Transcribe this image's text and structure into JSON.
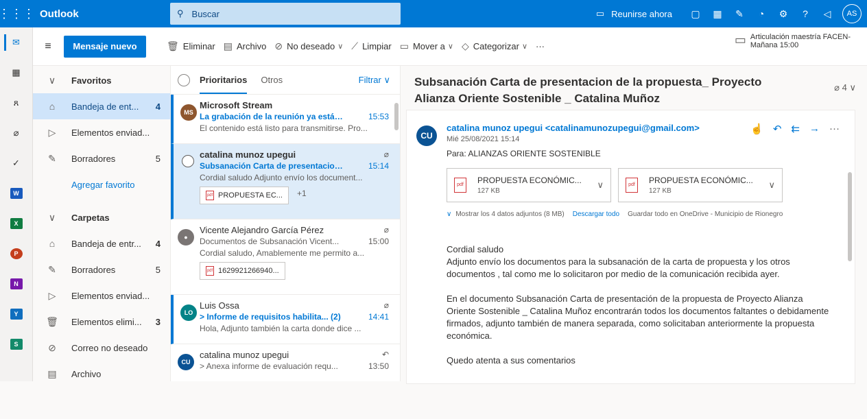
{
  "app": {
    "name": "Outlook",
    "user_initials": "AS"
  },
  "search": {
    "placeholder": "Buscar"
  },
  "topbar": {
    "meet_label": "Reunirse ahora"
  },
  "commands": {
    "new_message": "Mensaje nuevo",
    "delete": "Eliminar",
    "archive": "Archivo",
    "junk": "No deseado",
    "sweep": "Limpiar",
    "move": "Mover a",
    "categorize": "Categorizar",
    "more": "···"
  },
  "reminder": {
    "title": "Articulación maestría FACEN-",
    "time": "Mañana 15:00"
  },
  "folders": {
    "favorites_header": "Favoritos",
    "fav_inbox": "Bandeja de ent...",
    "fav_inbox_count": "4",
    "fav_sent": "Elementos enviad...",
    "fav_drafts": "Borradores",
    "fav_drafts_count": "5",
    "add_favorite": "Agregar favorito",
    "folders_header": "Carpetas",
    "inbox": "Bandeja de entr...",
    "inbox_count": "4",
    "drafts": "Borradores",
    "drafts_count": "5",
    "sent": "Elementos enviad...",
    "deleted": "Elementos elimi...",
    "deleted_count": "3",
    "junk": "Correo no deseado",
    "archive": "Archivo"
  },
  "list": {
    "tab_focused": "Prioritarios",
    "tab_other": "Otros",
    "filter": "Filtrar",
    "messages": [
      {
        "initials": "MS",
        "from": "Microsoft Stream",
        "subject": "La grabación de la reunión ya está l...",
        "time": "15:53",
        "preview": "El contenido está listo para transmitirse. Pro..."
      },
      {
        "from": "catalina munoz upegui",
        "subject": "Subsanación Carta de presentacion ...",
        "time": "15:14",
        "preview": "Cordial saludo Adjunto envío los document...",
        "attachment": "PROPUESTA EC...",
        "more": "+1"
      },
      {
        "from": "Vicente Alejandro García Pérez",
        "subject": "Documentos de Subsanación Vicent...",
        "time": "15:00",
        "preview": "Cordial saludo, Amablemente me permito a...",
        "attachment": "1629921266940..."
      },
      {
        "initials": "LO",
        "from": "Luis Ossa",
        "subject": "> Informe de requisitos habilita... (2)",
        "time": "14:41",
        "preview": "Hola, Adjunto también la carta donde dice ..."
      },
      {
        "initials": "CU",
        "from": "catalina munoz upegui",
        "subject": "> Anexa informe de evaluación requ...",
        "time": "13:50",
        "preview": ""
      }
    ]
  },
  "reading": {
    "subject": "Subsanación Carta de presentacion de la propuesta_ Proyecto Alianza Oriente Sostenible _ Catalina Muñoz",
    "attach_count": "4",
    "avatar": "CU",
    "sender": "catalina munoz upegui <catalinamunozupegui@gmail.com>",
    "date": "Mié 25/08/2021 15:14",
    "to": "Para:  ALIANZAS ORIENTE SOSTENIBLE",
    "attachments": [
      {
        "name": "PROPUESTA ECONÓMIC...",
        "size": "127 KB"
      },
      {
        "name": "PROPUESTA ECONÓMIC...",
        "size": "127 KB"
      }
    ],
    "show_all": "Mostrar los 4 datos adjuntos (8 MB)",
    "download_all": "Descargar todo",
    "save_onedrive": "Guardar todo en OneDrive - Municipio de Rionegro",
    "body1": "Cordial saludo",
    "body2": "Adjunto envío los documentos para la subsanación de la carta de propuesta y los otros documentos , tal como me lo solicitaron por medio de la comunicación recibida ayer.",
    "body3": "En el documento Subsanación Carta de presentación de la propuesta de Proyecto Alianza Oriente Sostenible _ Catalina Muñoz  encontrarán todos los documentos faltantes o debidamente firmados, adjunto también de manera separada, como solicitaban anteriormente la propuesta económica.",
    "body4": "Quedo atenta a sus comentarios"
  }
}
